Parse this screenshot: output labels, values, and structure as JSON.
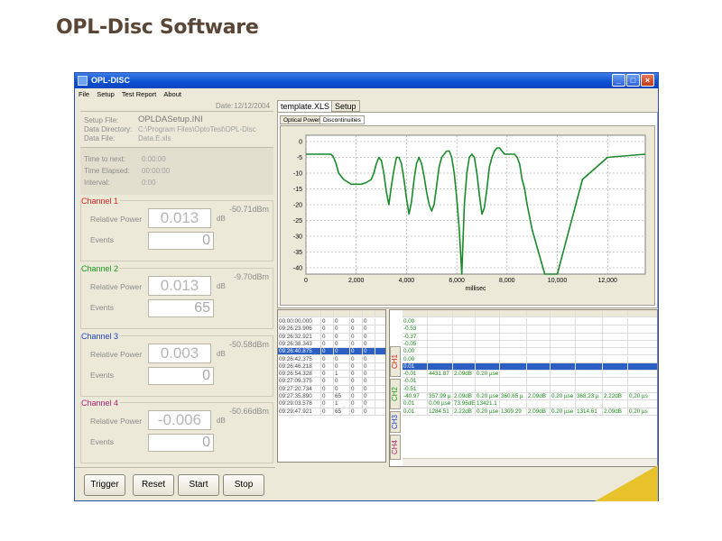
{
  "page_title": "OPL-Disc Software",
  "window": {
    "title": "OPL-DISC",
    "menu": [
      "File",
      "Setup",
      "Test Report",
      "About"
    ],
    "minimize": "_",
    "maximize": "□",
    "close": "×"
  },
  "info": {
    "date_label": "Date:",
    "date": "12/12/2004",
    "setup_file_label": "Setup File:",
    "setup_file": "OPLDASetup.INI",
    "data_directory_label": "Data Directory:",
    "data_directory": "C:\\Program Files\\OptoTest\\OPL-Disc",
    "data_file_label": "Data File:",
    "data_file": "Data.E.xls",
    "time_to_next_label": "Time to next:",
    "time_to_next": "0:00:00",
    "time_elapsed_label": "Time Elapsed:",
    "time_elapsed": "00:00:00",
    "interval_label": "Interval:",
    "interval": "0:00"
  },
  "channels": [
    {
      "name": "Channel 1",
      "dbm": "-50.71dBm",
      "rp_label": "Relative Power",
      "rp": "0.013",
      "unit": "dB",
      "ev_label": "Events",
      "events": "0",
      "color": "#d62020"
    },
    {
      "name": "Channel 2",
      "dbm": "-9.70dBm",
      "rp_label": "Relative Power",
      "rp": "0.013",
      "unit": "dB",
      "ev_label": "Events",
      "events": "65",
      "color": "#1a9a1a"
    },
    {
      "name": "Channel 3",
      "dbm": "-50.58dBm",
      "rp_label": "Relative Power",
      "rp": "0.003",
      "unit": "dB",
      "ev_label": "Events",
      "events": "0",
      "color": "#2040c8"
    },
    {
      "name": "Channel 4",
      "dbm": "-50.66dBm",
      "rp_label": "Relative Power",
      "rp": "-0.006",
      "unit": "dB",
      "ev_label": "Events",
      "events": "0",
      "color": "#b02070"
    }
  ],
  "buttons": {
    "trigger": "Trigger",
    "reset": "Reset",
    "start": "Start",
    "stop": "Stop"
  },
  "tabs": {
    "template": "template.XLS",
    "setup": "Setup",
    "optical_power": "Optical Power",
    "discontinuities": "Discontinuities"
  },
  "left_table": [
    [
      "00:00:00.000",
      "0",
      "0",
      "0",
      "0"
    ],
    [
      "09:26:23.906",
      "0",
      "0",
      "0",
      "0"
    ],
    [
      "09:26:32.921",
      "0",
      "0",
      "0",
      "0"
    ],
    [
      "09:26:38.343",
      "0",
      "0",
      "0",
      "0"
    ],
    [
      "09:26:40.875",
      "0",
      "0",
      "0",
      "0"
    ],
    [
      "09:26:42.375",
      "0",
      "0",
      "0",
      "0"
    ],
    [
      "09:26:46.218",
      "0",
      "0",
      "0",
      "0"
    ],
    [
      "09:26:54.328",
      "0",
      "1",
      "0",
      "0"
    ],
    [
      "09:27:09.375",
      "0",
      "0",
      "0",
      "0"
    ],
    [
      "09:27:20.734",
      "0",
      "0",
      "0",
      "0"
    ],
    [
      "09:27:35.890",
      "0",
      "65",
      "0",
      "0"
    ],
    [
      "09:29:03.578",
      "0",
      "1",
      "0",
      "0"
    ],
    [
      "09:29:47.921",
      "0",
      "65",
      "0",
      "0"
    ]
  ],
  "channel_tabs": [
    "CH1",
    "CH2",
    "CH3",
    "CH4"
  ],
  "right_table": [
    [
      "0.00",
      "",
      "",
      "",
      "",
      "",
      "",
      "",
      "",
      ""
    ],
    [
      "-0.53",
      "",
      "",
      "",
      "",
      "",
      "",
      "",
      "",
      ""
    ],
    [
      "-0.37",
      "",
      "",
      "",
      "",
      "",
      "",
      "",
      "",
      ""
    ],
    [
      "-0.05",
      "",
      "",
      "",
      "",
      "",
      "",
      "",
      "",
      ""
    ],
    [
      "0.00",
      "",
      "",
      "",
      "",
      "",
      "",
      "",
      "",
      ""
    ],
    [
      "0.00",
      "",
      "",
      "",
      "",
      "",
      "",
      "",
      "",
      ""
    ],
    [
      "0.01",
      "",
      "",
      "",
      "",
      "",
      "",
      "",
      "",
      ""
    ],
    [
      "-0.01",
      "4431.87",
      "2.09dB",
      "0.20 µse",
      "",
      "",
      "",
      "",
      "",
      ""
    ],
    [
      "-0.01",
      "",
      "",
      "",
      "",
      "",
      "",
      "",
      "",
      ""
    ],
    [
      "-0.51",
      "",
      "",
      "",
      "",
      "",
      "",
      "",
      "",
      ""
    ],
    [
      "-40.97",
      "357.99 µ",
      "2.09dB",
      "0.20 µse",
      "360.65 µ",
      "2.09dB",
      "0.20 µse",
      "368.23 µ",
      "2.22dB",
      "0.20 µs"
    ],
    [
      "0.01",
      "0.00 µse",
      "73.95dE",
      "13421.1",
      "",
      "",
      "",
      "",
      "",
      ""
    ],
    [
      "0.01",
      "1284.51",
      "2.22dB",
      "0.20 µse",
      "1309.29",
      "2.09dB",
      "0.20 µse",
      "1314.61",
      "2.09dB",
      "0.20 µs"
    ]
  ],
  "chart_data": {
    "type": "line",
    "xlabel": "millisec",
    "ylabel": "",
    "xlim": [
      0,
      13500
    ],
    "ylim": [
      -42,
      2
    ],
    "xticks": [
      "0",
      "2,000",
      "4,000",
      "6,000",
      "8,000",
      "10,000",
      "12,000"
    ],
    "yticks": [
      "0",
      "-5",
      "-10",
      "-15",
      "-20",
      "-25",
      "-30",
      "-35",
      "-40"
    ],
    "grid": true,
    "series": [
      {
        "color": "#1a8a2a",
        "x": [
          0,
          1000,
          1100,
          1200,
          1300,
          1500,
          1800,
          2000,
          2200,
          2400,
          2600,
          2700,
          2800,
          2900,
          3000,
          3100,
          3200,
          3300,
          3400,
          3500,
          3600,
          3700,
          3800,
          3900,
          4000,
          4100,
          4200,
          4300,
          4400,
          4500,
          4600,
          4700,
          4800,
          4900,
          5000,
          5100,
          5200,
          5300,
          5400,
          5500,
          5600,
          5700,
          5800,
          5900,
          6000,
          6100,
          6200,
          6300,
          6400,
          6500,
          6600,
          6700,
          6800,
          6900,
          7000,
          7100,
          7200,
          7300,
          7400,
          7500,
          7600,
          7700,
          7800,
          7900,
          8000,
          8100,
          8200,
          8300,
          8400,
          8500,
          8600,
          8700,
          8800,
          9000,
          9500,
          10000,
          11000,
          12000,
          13500
        ],
        "y": [
          -4,
          -4,
          -5,
          -7,
          -10,
          -12,
          -13.5,
          -13.5,
          -13.5,
          -13,
          -12,
          -10,
          -7,
          -5,
          -6,
          -10,
          -16,
          -20,
          -14,
          -9,
          -5,
          -5,
          -7,
          -12,
          -18,
          -23,
          -19,
          -12,
          -7,
          -5,
          -7,
          -11,
          -16,
          -20,
          -22,
          -20,
          -14,
          -8,
          -5,
          -4,
          -3,
          -3,
          -5,
          -10,
          -18,
          -28,
          -44,
          -20,
          -10,
          -5,
          -4,
          -5,
          -10,
          -17,
          -23,
          -21,
          -15,
          -8,
          -5,
          -3,
          -2,
          -2,
          -3,
          -4,
          -4,
          -4,
          -4,
          -4,
          -5,
          -7,
          -12,
          -15,
          -20,
          -28,
          -44,
          -44,
          -12,
          -5,
          -4
        ]
      }
    ]
  }
}
